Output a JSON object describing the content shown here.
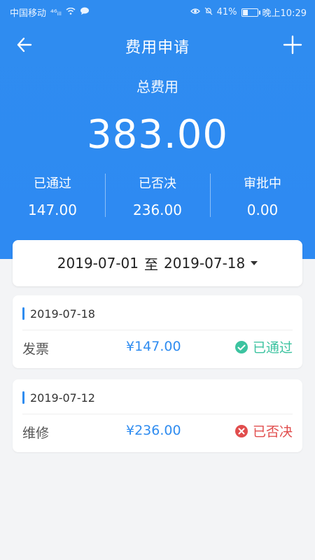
{
  "status_bar": {
    "carrier": "中国移动",
    "signal": "⁴⁶ᵢₗₗ",
    "battery": "41%",
    "time": "晚上10:29",
    "battery_level": 0.41
  },
  "header": {
    "title": "费用申请",
    "total_label": "总费用",
    "total_value": "383.00",
    "stats": [
      {
        "label": "已通过",
        "value": "147.00"
      },
      {
        "label": "已否决",
        "value": "236.00"
      },
      {
        "label": "审批中",
        "value": "0.00"
      }
    ]
  },
  "date_filter": {
    "start": "2019-07-01",
    "separator": "至",
    "end": "2019-07-18"
  },
  "records": [
    {
      "date": "2019-07-18",
      "type": "发票",
      "amount": "¥147.00",
      "status": "已通过",
      "status_kind": "approved"
    },
    {
      "date": "2019-07-12",
      "type": "维修",
      "amount": "¥236.00",
      "status": "已否决",
      "status_kind": "rejected"
    }
  ],
  "colors": {
    "brand": "#2f8cf0",
    "approved": "#3cc3a0",
    "rejected": "#e14d4d"
  },
  "icons": {
    "back": "arrow-left-icon",
    "add": "plus-icon",
    "approved": "check-circle-icon",
    "rejected": "x-circle-icon",
    "dropdown": "caret-down-icon"
  }
}
